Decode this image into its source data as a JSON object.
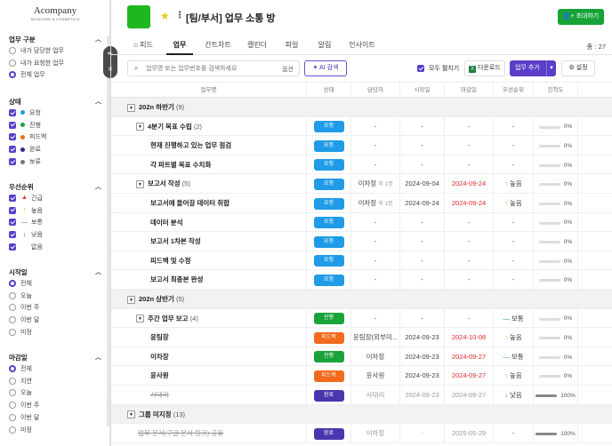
{
  "logo": {
    "name": "Acompany",
    "tagline": "SKINCARE & COSMETICS"
  },
  "colors": {
    "accent": "#5a3ec8",
    "green": "#17a238",
    "badge_blue": "#1f9be8",
    "badge_green": "#1aa33b",
    "badge_orange": "#f26a1b",
    "badge_purple": "#4b36b0",
    "late_red": "#e32a2a"
  },
  "sidebar": {
    "task_type": {
      "title": "업무 구분",
      "options": [
        "내가 담당한 업무",
        "내가 요청한 업무",
        "전체 업무"
      ],
      "selected": 2
    },
    "status": {
      "title": "상태",
      "items": [
        {
          "label": "요청",
          "color": "#1f9be8"
        },
        {
          "label": "진행",
          "color": "#1aa33b"
        },
        {
          "label": "피드백",
          "color": "#f26a1b"
        },
        {
          "label": "완료",
          "color": "#2c2c8c"
        },
        {
          "label": "보류",
          "color": "#777777"
        }
      ]
    },
    "priority": {
      "title": "우선순위",
      "items": [
        {
          "label": "긴급",
          "icon": "siren-icon",
          "glyph": "▲"
        },
        {
          "label": "높음",
          "icon": "arrow-up-icon",
          "glyph": "↑"
        },
        {
          "label": "보통",
          "icon": "dash-icon",
          "glyph": "—"
        },
        {
          "label": "낮음",
          "icon": "arrow-down-icon",
          "glyph": "↓"
        },
        {
          "label": "없음",
          "icon": "",
          "glyph": ""
        }
      ]
    },
    "start_date": {
      "title": "시작일",
      "options": [
        "전체",
        "오늘",
        "이번 주",
        "이번 달",
        "미정"
      ],
      "selected": 0
    },
    "due_date": {
      "title": "마감일",
      "options": [
        "전체",
        "지연",
        "오늘",
        "이번 주",
        "이번 달",
        "미정"
      ],
      "selected": 0
    }
  },
  "header": {
    "title": "[팀/부서] 업무 소통 방",
    "invite_label": "초대하기"
  },
  "tabs": [
    "피드",
    "업무",
    "간트차트",
    "캘린더",
    "파일",
    "알림",
    "인사이트"
  ],
  "active_tab": 1,
  "total_label": "총 : 27",
  "toolbar": {
    "search_placeholder": "업무명 또는 업무번호를 검색하세요",
    "search_option": "옵션",
    "ai_label": "AI 검색",
    "expand_label": "모두 펼치기",
    "download_label": "다운로드",
    "add_label": "업무 추가",
    "settings_label": "설정"
  },
  "columns": [
    "업무명",
    "상태",
    "담당자",
    "시작일",
    "마감일",
    "우선순위",
    "진척도"
  ],
  "rows": [
    {
      "kind": "group",
      "name": "202n 하반기",
      "count": "(9)"
    },
    {
      "kind": "parent",
      "name": "4분기 목표 수립",
      "count": "(2)",
      "status": "요청",
      "scolor": "#1f9be8",
      "assignee": "-",
      "start": "-",
      "due": "-",
      "priority": "-",
      "progress": "0%",
      "pval": 0
    },
    {
      "kind": "child",
      "name": "현재 진행하고 있는 업무 점검",
      "status": "요청",
      "scolor": "#1f9be8",
      "assignee": "-",
      "start": "-",
      "due": "-",
      "priority": "-",
      "progress": "0%",
      "pval": 0
    },
    {
      "kind": "child",
      "name": "각 파트별 목표 수치화",
      "status": "요청",
      "scolor": "#1f9be8",
      "assignee": "-",
      "start": "-",
      "due": "-",
      "priority": "-",
      "progress": "0%",
      "pval": 0
    },
    {
      "kind": "parent",
      "name": "보고서 작성",
      "count": "(5)",
      "status": "요청",
      "scolor": "#1f9be8",
      "assignee": "이차장",
      "assignee_extra": "외 1명",
      "start": "2024-09-04",
      "due": "2024-09-24",
      "due_red": true,
      "priority": "높음",
      "pglyph": "↑",
      "pcolor": "#e8a317",
      "progress": "0%",
      "pval": 0
    },
    {
      "kind": "child",
      "name": "보고서에 들어갈 데이터 취합",
      "status": "요청",
      "scolor": "#1f9be8",
      "assignee": "이차장",
      "assignee_extra": "외 1명",
      "start": "2024-09-24",
      "due": "2024-09-24",
      "due_red": true,
      "priority": "높음",
      "pglyph": "↑",
      "pcolor": "#e8a317",
      "progress": "0%",
      "pval": 0
    },
    {
      "kind": "child",
      "name": "데이터 분석",
      "status": "요청",
      "scolor": "#1f9be8",
      "assignee": "-",
      "start": "-",
      "due": "-",
      "priority": "-",
      "progress": "0%",
      "pval": 0
    },
    {
      "kind": "child",
      "name": "보고서 1차본 작성",
      "status": "요청",
      "scolor": "#1f9be8",
      "assignee": "-",
      "start": "-",
      "due": "-",
      "priority": "-",
      "progress": "0%",
      "pval": 0
    },
    {
      "kind": "child",
      "name": "피드백 및 수정",
      "status": "요청",
      "scolor": "#1f9be8",
      "assignee": "-",
      "start": "-",
      "due": "-",
      "priority": "-",
      "progress": "0%",
      "pval": 0
    },
    {
      "kind": "child",
      "name": "보고서 최종본 완성",
      "status": "요청",
      "scolor": "#1f9be8",
      "assignee": "-",
      "start": "-",
      "due": "-",
      "priority": "-",
      "progress": "0%",
      "pval": 0
    },
    {
      "kind": "group",
      "name": "202n 상반기",
      "count": "(5)"
    },
    {
      "kind": "parent",
      "name": "주간 업무 보고",
      "count": "(4)",
      "status": "진행",
      "scolor": "#1aa33b",
      "assignee": "-",
      "start": "-",
      "due": "-",
      "priority": "보통",
      "pglyph": "—",
      "pcolor": "#2aa84a",
      "progress": "0%",
      "pval": 0
    },
    {
      "kind": "child",
      "name": "윤팀장",
      "status": "피드백",
      "scolor": "#f26a1b",
      "assignee": "윤팀장(외부미...",
      "start": "2024-09-23",
      "due": "2024-10-08",
      "due_red": true,
      "priority": "높음",
      "pglyph": "↑",
      "pcolor": "#e8a317",
      "progress": "0%",
      "pval": 0
    },
    {
      "kind": "child",
      "name": "이차장",
      "status": "진행",
      "scolor": "#1aa33b",
      "assignee": "이차장",
      "start": "2024-09-23",
      "due": "2024-09-27",
      "due_red": true,
      "priority": "보통",
      "pglyph": "—",
      "pcolor": "#2aa84a",
      "progress": "0%",
      "pval": 0
    },
    {
      "kind": "child",
      "name": "윤사원",
      "status": "피드백",
      "scolor": "#f26a1b",
      "assignee": "윤사원",
      "start": "2024-09-23",
      "due": "2024-09-27",
      "due_red": true,
      "priority": "높음",
      "pglyph": "↑",
      "pcolor": "#e8a317",
      "progress": "0%",
      "pval": 0
    },
    {
      "kind": "child",
      "name": "사대리",
      "strike": true,
      "status": "완료",
      "scolor": "#4b36b0",
      "assignee": "사대리",
      "start": "2024-09-23",
      "due": "2024-09-27",
      "priority": "낮음",
      "pglyph": "↓",
      "pcolor": "#666",
      "progress": "100%",
      "pval": 100
    },
    {
      "kind": "group",
      "name": "그룹 미지정",
      "count": "(13)"
    },
    {
      "kind": "plain",
      "name": "업무 문서(구글 문서 링크) 공유",
      "strike": true,
      "status": "완료",
      "scolor": "#4b36b0",
      "assignee": "이차장",
      "start": "-",
      "due": "2025-05-29",
      "priority": "-",
      "progress": "100%",
      "pval": 100
    }
  ]
}
